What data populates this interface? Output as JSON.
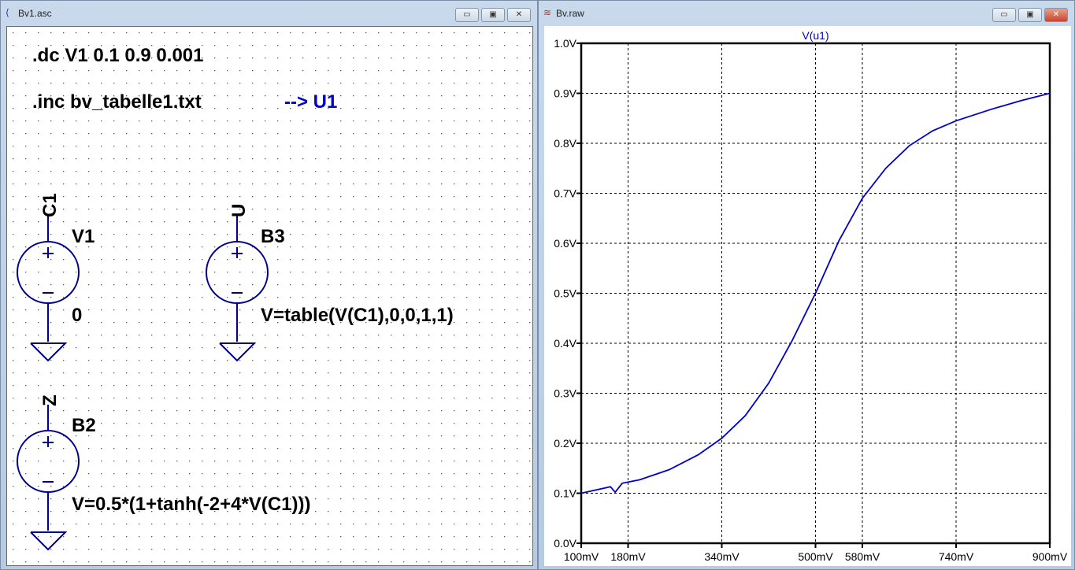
{
  "schematic": {
    "title": "Bv1.asc",
    "directives": [
      ".dc V1 0.1 0.9 0.001",
      ".inc bv_tabelle1.txt"
    ],
    "comment": "--> U1",
    "v1": {
      "net": "C1",
      "name": "V1",
      "value": "0"
    },
    "b3": {
      "net": "U",
      "name": "B3",
      "value": "V=table(V(C1),0,0,1,1)"
    },
    "b2": {
      "net": "Z",
      "name": "B2",
      "value": "V=0.5*(1+tanh(-2+4*V(C1)))"
    }
  },
  "waveform": {
    "title": "Bv.raw"
  },
  "buttons": {
    "min": "▭",
    "max": "▣",
    "close": "✕"
  },
  "colors": {
    "trace": "#0000c8"
  },
  "chart_data": {
    "type": "line",
    "title": "V(u1)",
    "xlabel": "",
    "ylabel": "",
    "xlim": [
      0.1,
      0.9
    ],
    "ylim": [
      0,
      1
    ],
    "xticks": [
      {
        "v": 0.1,
        "label": "100mV"
      },
      {
        "v": 0.18,
        "label": "180mV"
      },
      {
        "v": 0.34,
        "label": "340mV"
      },
      {
        "v": 0.5,
        "label": "500mV"
      },
      {
        "v": 0.58,
        "label": "580mV"
      },
      {
        "v": 0.74,
        "label": "740mV"
      },
      {
        "v": 0.9,
        "label": "900mV"
      }
    ],
    "yticks": [
      {
        "v": 0,
        "label": "0.0V"
      },
      {
        "v": 0.1,
        "label": "0.1V"
      },
      {
        "v": 0.2,
        "label": "0.2V"
      },
      {
        "v": 0.3,
        "label": "0.3V"
      },
      {
        "v": 0.4,
        "label": "0.4V"
      },
      {
        "v": 0.5,
        "label": "0.5V"
      },
      {
        "v": 0.6,
        "label": "0.6V"
      },
      {
        "v": 0.7,
        "label": "0.7V"
      },
      {
        "v": 0.8,
        "label": "0.8V"
      },
      {
        "v": 0.9,
        "label": "0.9V"
      },
      {
        "v": 1.0,
        "label": "1.0V"
      }
    ],
    "series": [
      {
        "name": "V(u1)",
        "x": [
          0.1,
          0.15,
          0.158,
          0.17,
          0.2,
          0.25,
          0.3,
          0.34,
          0.38,
          0.42,
          0.46,
          0.5,
          0.54,
          0.58,
          0.62,
          0.66,
          0.7,
          0.74,
          0.8,
          0.85,
          0.9
        ],
        "y": [
          0.1,
          0.113,
          0.102,
          0.12,
          0.127,
          0.147,
          0.177,
          0.21,
          0.255,
          0.32,
          0.405,
          0.5,
          0.605,
          0.69,
          0.75,
          0.795,
          0.825,
          0.845,
          0.868,
          0.885,
          0.9
        ]
      }
    ]
  }
}
